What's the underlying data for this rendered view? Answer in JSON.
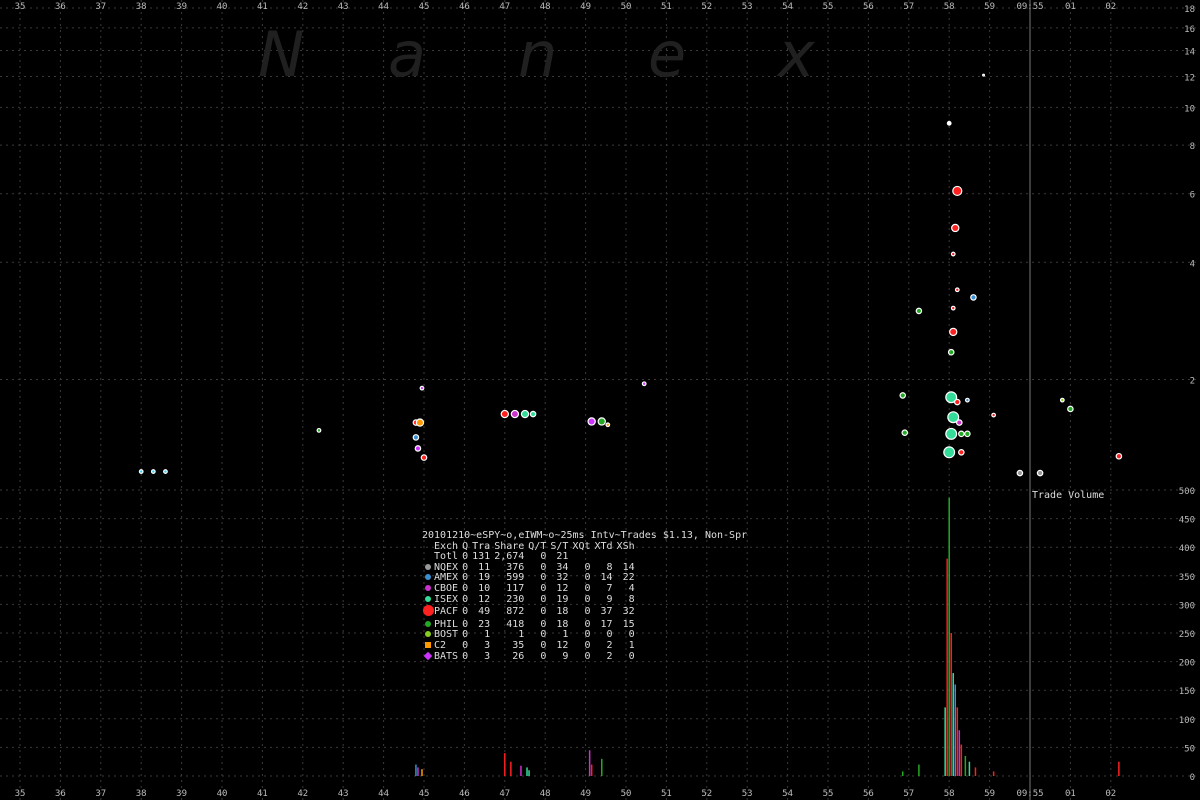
{
  "chart_data": {
    "type": "scatter",
    "title": "20101210~eSPY~o,eIWM~o~25ms Intv~Trades $1.13, Non-Spr",
    "watermark": [
      "N",
      "a",
      "n",
      "e",
      "x"
    ],
    "x_ticks": [
      "35",
      "36",
      "37",
      "38",
      "39",
      "40",
      "41",
      "42",
      "43",
      "44",
      "45",
      "46",
      "47",
      "48",
      "49",
      "50",
      "51",
      "52",
      "53",
      "54",
      "55",
      "56",
      "57",
      "58",
      "59",
      "09:55",
      "01",
      "02"
    ],
    "marker_time": "09:55",
    "price_axis": {
      "ticks": [
        "2",
        "4",
        "6",
        "8",
        "10",
        "12",
        "14",
        "16",
        "18"
      ],
      "ylim": [
        1.13,
        18
      ]
    },
    "volume_axis": {
      "label": "Trade Volume",
      "ticks": [
        "0",
        "50",
        "100",
        "150",
        "200",
        "250",
        "300",
        "350",
        "400",
        "450",
        "500"
      ],
      "ylim": [
        0,
        500
      ]
    },
    "grid": true,
    "exchanges": [
      {
        "name": "NQEX",
        "color": "#999999",
        "marker": "dot"
      },
      {
        "name": "AMEX",
        "color": "#3a8fd0",
        "marker": "dot"
      },
      {
        "name": "CBOE",
        "color": "#cc33cc",
        "marker": "dot"
      },
      {
        "name": "ISEX",
        "color": "#33dd99",
        "marker": "dot"
      },
      {
        "name": "PACF",
        "color": "#ff2020",
        "marker": "dot"
      },
      {
        "name": "PHIL",
        "color": "#22aa22",
        "marker": "dot"
      },
      {
        "name": "BOST",
        "color": "#88cc22",
        "marker": "dot"
      },
      {
        "name": "C2",
        "color": "#ff9900",
        "marker": "square"
      },
      {
        "name": "BATS",
        "color": "#cc33ff",
        "marker": "diamond"
      }
    ],
    "price_points": [
      {
        "t": 38.0,
        "p": 1.16,
        "c": "#33ccff",
        "s": 2
      },
      {
        "t": 38.3,
        "p": 1.16,
        "c": "#33ccff",
        "s": 2
      },
      {
        "t": 38.6,
        "p": 1.16,
        "c": "#33ccff",
        "s": 2
      },
      {
        "t": 42.4,
        "p": 1.48,
        "c": "#22aa22",
        "s": 2
      },
      {
        "t": 44.8,
        "p": 1.55,
        "c": "#ff2020",
        "s": 3
      },
      {
        "t": 44.9,
        "p": 1.55,
        "c": "#ff9900",
        "s": 4
      },
      {
        "t": 44.95,
        "p": 1.9,
        "c": "#cc33ff",
        "s": 2
      },
      {
        "t": 44.8,
        "p": 1.42,
        "c": "#3a8fd0",
        "s": 3
      },
      {
        "t": 44.85,
        "p": 1.33,
        "c": "#cc33ff",
        "s": 3
      },
      {
        "t": 45.0,
        "p": 1.26,
        "c": "#ff2020",
        "s": 3
      },
      {
        "t": 47.0,
        "p": 1.63,
        "c": "#ff2020",
        "s": 4
      },
      {
        "t": 47.25,
        "p": 1.63,
        "c": "#cc33cc",
        "s": 4
      },
      {
        "t": 47.5,
        "p": 1.63,
        "c": "#33dd99",
        "s": 4
      },
      {
        "t": 47.7,
        "p": 1.63,
        "c": "#33dd99",
        "s": 3
      },
      {
        "t": 49.15,
        "p": 1.56,
        "c": "#cc33ff",
        "s": 4
      },
      {
        "t": 49.4,
        "p": 1.56,
        "c": "#22aa22",
        "s": 4
      },
      {
        "t": 49.55,
        "p": 1.53,
        "c": "#ff9900",
        "s": 2
      },
      {
        "t": 50.45,
        "p": 1.95,
        "c": "#cc33ff",
        "s": 2
      },
      {
        "t": 56.85,
        "p": 1.82,
        "c": "#22aa22",
        "s": 3
      },
      {
        "t": 56.9,
        "p": 1.46,
        "c": "#22aa22",
        "s": 3
      },
      {
        "t": 57.25,
        "p": 3.0,
        "c": "#22aa22",
        "s": 3
      },
      {
        "t": 58.0,
        "p": 9.1,
        "c": "#ffffff",
        "s": 2
      },
      {
        "t": 58.2,
        "p": 6.1,
        "c": "#ff2020",
        "s": 5
      },
      {
        "t": 58.15,
        "p": 4.9,
        "c": "#ff2020",
        "s": 4
      },
      {
        "t": 58.1,
        "p": 4.2,
        "c": "#ff2020",
        "s": 2
      },
      {
        "t": 58.2,
        "p": 3.4,
        "c": "#ff2020",
        "s": 2
      },
      {
        "t": 58.1,
        "p": 3.05,
        "c": "#ff2020",
        "s": 2
      },
      {
        "t": 58.1,
        "p": 2.65,
        "c": "#ff2020",
        "s": 4
      },
      {
        "t": 58.05,
        "p": 2.35,
        "c": "#22aa22",
        "s": 3
      },
      {
        "t": 58.6,
        "p": 3.25,
        "c": "#3a8fd0",
        "s": 3
      },
      {
        "t": 58.05,
        "p": 1.8,
        "c": "#33dd99",
        "s": 6
      },
      {
        "t": 58.1,
        "p": 1.6,
        "c": "#33dd99",
        "s": 6
      },
      {
        "t": 58.05,
        "p": 1.45,
        "c": "#33dd99",
        "s": 6
      },
      {
        "t": 58.0,
        "p": 1.3,
        "c": "#33dd99",
        "s": 6
      },
      {
        "t": 58.2,
        "p": 1.75,
        "c": "#ff2020",
        "s": 3
      },
      {
        "t": 58.25,
        "p": 1.55,
        "c": "#cc33cc",
        "s": 3
      },
      {
        "t": 58.3,
        "p": 1.45,
        "c": "#22aa22",
        "s": 3
      },
      {
        "t": 58.45,
        "p": 1.45,
        "c": "#22aa22",
        "s": 3
      },
      {
        "t": 58.45,
        "p": 1.77,
        "c": "#3a8fd0",
        "s": 2
      },
      {
        "t": 58.3,
        "p": 1.3,
        "c": "#ff2020",
        "s": 3
      },
      {
        "t": 58.85,
        "p": 12.1,
        "c": "#ff2020",
        "s": 1
      },
      {
        "t": 59.1,
        "p": 1.62,
        "c": "#ff2020",
        "s": 2
      },
      {
        "t": 59.75,
        "p": 1.15,
        "c": "#999999",
        "s": 3
      },
      {
        "t": 60.25,
        "p": 1.15,
        "c": "#999999",
        "s": 3
      },
      {
        "t": 60.8,
        "p": 1.77,
        "c": "#88cc22",
        "s": 2
      },
      {
        "t": 61.0,
        "p": 1.68,
        "c": "#22aa22",
        "s": 3
      },
      {
        "t": 62.2,
        "p": 1.27,
        "c": "#ff2020",
        "s": 3
      }
    ],
    "volume_bars": [
      {
        "t": 44.8,
        "v": 20,
        "c": "#3a8fd0"
      },
      {
        "t": 44.85,
        "v": 15,
        "c": "#cc33cc"
      },
      {
        "t": 44.95,
        "v": 12,
        "c": "#ff9900"
      },
      {
        "t": 47.0,
        "v": 40,
        "c": "#ff2020"
      },
      {
        "t": 47.15,
        "v": 25,
        "c": "#ff2020"
      },
      {
        "t": 47.4,
        "v": 18,
        "c": "#cc33cc"
      },
      {
        "t": 47.55,
        "v": 15,
        "c": "#33dd99"
      },
      {
        "t": 47.6,
        "v": 10,
        "c": "#33dd99"
      },
      {
        "t": 49.1,
        "v": 45,
        "c": "#cc33cc"
      },
      {
        "t": 49.15,
        "v": 20,
        "c": "#ff2020"
      },
      {
        "t": 49.4,
        "v": 30,
        "c": "#22aa22"
      },
      {
        "t": 56.85,
        "v": 8,
        "c": "#22aa22"
      },
      {
        "t": 57.25,
        "v": 20,
        "c": "#22aa22"
      },
      {
        "t": 57.9,
        "v": 120,
        "c": "#33dd99"
      },
      {
        "t": 57.95,
        "v": 380,
        "c": "#ff2020"
      },
      {
        "t": 58.0,
        "v": 487,
        "c": "#22aa22"
      },
      {
        "t": 58.05,
        "v": 250,
        "c": "#ff2020"
      },
      {
        "t": 58.1,
        "v": 180,
        "c": "#33dd99"
      },
      {
        "t": 58.15,
        "v": 160,
        "c": "#3a8fd0"
      },
      {
        "t": 58.2,
        "v": 120,
        "c": "#ff2020"
      },
      {
        "t": 58.25,
        "v": 80,
        "c": "#cc33cc"
      },
      {
        "t": 58.3,
        "v": 55,
        "c": "#ff2020"
      },
      {
        "t": 58.4,
        "v": 35,
        "c": "#22aa22"
      },
      {
        "t": 58.5,
        "v": 25,
        "c": "#33dd99"
      },
      {
        "t": 58.65,
        "v": 15,
        "c": "#ff2020"
      },
      {
        "t": 59.1,
        "v": 8,
        "c": "#ff2020"
      },
      {
        "t": 62.2,
        "v": 25,
        "c": "#ff2020"
      }
    ]
  },
  "stats": {
    "header": [
      "Exch",
      "Q",
      "Tra",
      "Share",
      "Q/T",
      "S/T",
      "XQt",
      "XTd",
      "XSh"
    ],
    "total": {
      "name": "Totl",
      "q": "0",
      "tra": "131",
      "share": "2,674",
      "qt": "0",
      "st": "21",
      "xqt": "",
      "xtd": "",
      "xsh": ""
    },
    "rows": [
      {
        "name": "NQEX",
        "q": "0",
        "tra": "11",
        "share": "376",
        "qt": "0",
        "st": "34",
        "xqt": "0",
        "xtd": "8",
        "xsh": "14"
      },
      {
        "name": "AMEX",
        "q": "0",
        "tra": "19",
        "share": "599",
        "qt": "0",
        "st": "32",
        "xqt": "0",
        "xtd": "14",
        "xsh": "22"
      },
      {
        "name": "CBOE",
        "q": "0",
        "tra": "10",
        "share": "117",
        "qt": "0",
        "st": "12",
        "xqt": "0",
        "xtd": "7",
        "xsh": "4"
      },
      {
        "name": "ISEX",
        "q": "0",
        "tra": "12",
        "share": "230",
        "qt": "0",
        "st": "19",
        "xqt": "0",
        "xtd": "9",
        "xsh": "8"
      },
      {
        "name": "PACF",
        "q": "0",
        "tra": "49",
        "share": "872",
        "qt": "0",
        "st": "18",
        "xqt": "0",
        "xtd": "37",
        "xsh": "32"
      },
      {
        "name": "PHIL",
        "q": "0",
        "tra": "23",
        "share": "418",
        "qt": "0",
        "st": "18",
        "xqt": "0",
        "xtd": "17",
        "xsh": "15"
      },
      {
        "name": "BOST",
        "q": "0",
        "tra": "1",
        "share": "1",
        "qt": "0",
        "st": "1",
        "xqt": "0",
        "xtd": "0",
        "xsh": "0"
      },
      {
        "name": "C2",
        "q": "0",
        "tra": "3",
        "share": "35",
        "qt": "0",
        "st": "12",
        "xqt": "0",
        "xtd": "2",
        "xsh": "1"
      },
      {
        "name": "BATS",
        "q": "0",
        "tra": "3",
        "share": "26",
        "qt": "0",
        "st": "9",
        "xqt": "0",
        "xtd": "2",
        "xsh": "0"
      }
    ]
  }
}
